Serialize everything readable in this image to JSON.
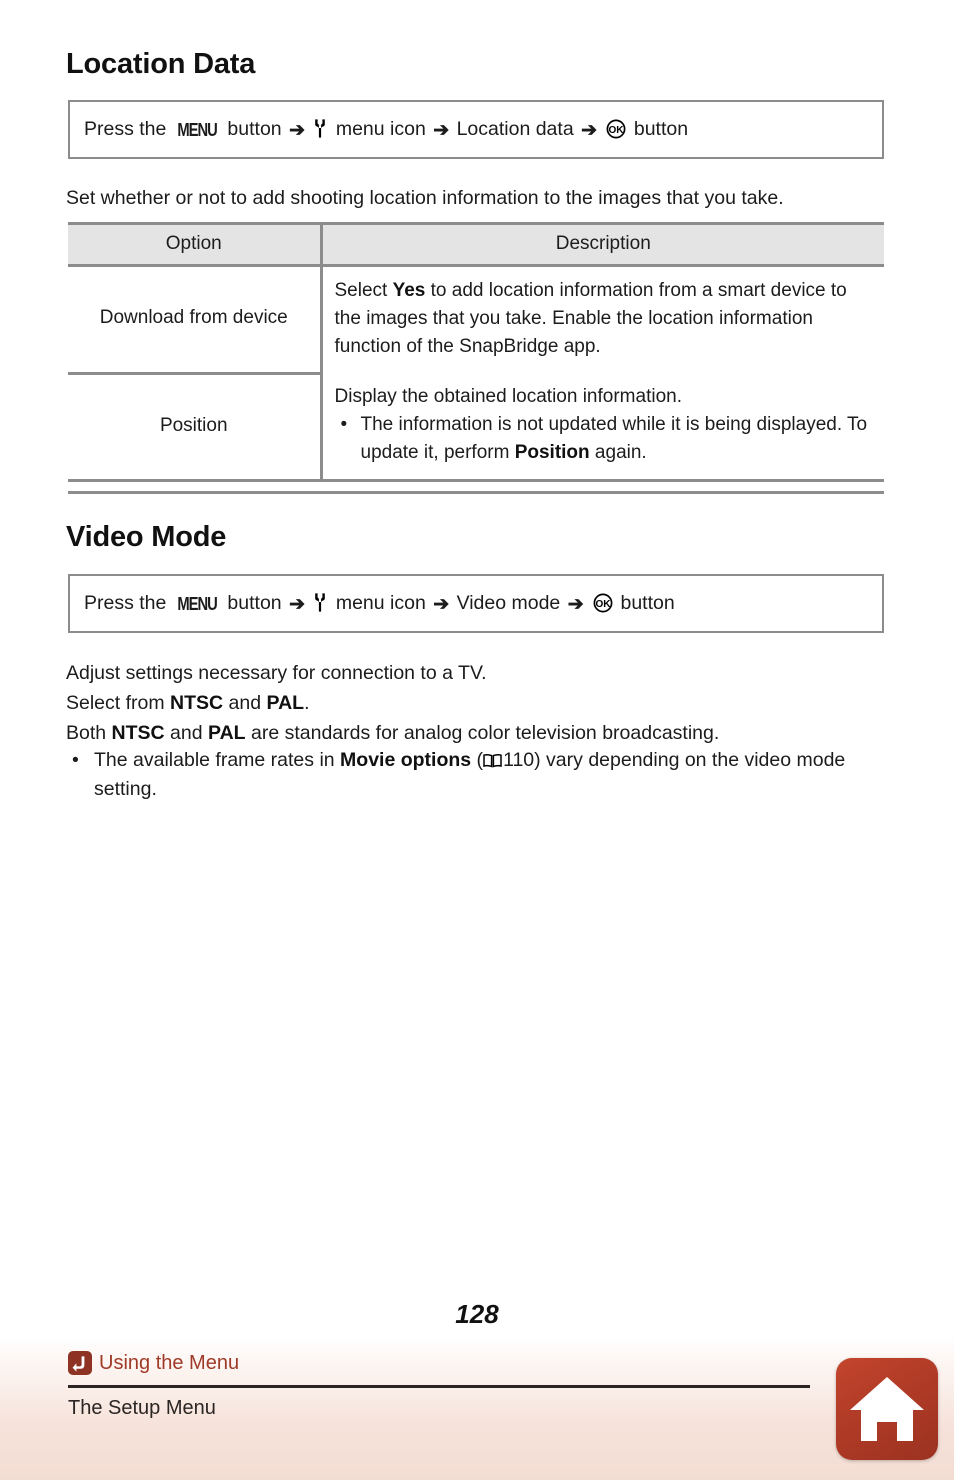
{
  "document": {
    "page_number": "128"
  },
  "location_section": {
    "title": "Location Data",
    "instruction": {
      "press_the": "Press the",
      "menu_glyph": "MENU",
      "button_1": "button",
      "arrow": "➔",
      "wrench_icon": "wrench-setup-menu-icon",
      "menu_icon_label": "menu icon",
      "item": "Location data",
      "ok_glyph": "OK",
      "button_2": "button"
    },
    "intro": "Set whether or not to add shooting location information to the images that you take.",
    "table": {
      "headers": [
        "Option",
        "Description"
      ],
      "rows": [
        {
          "option": "Download from device",
          "description_parts": [
            {
              "text": "Select ",
              "bold": false
            },
            {
              "text": "Yes",
              "bold": true
            },
            {
              "text": " to add location information from a smart device to the images that you take. Enable the location information function of the SnapBridge app.",
              "bold": false
            }
          ]
        },
        {
          "option": "Position",
          "description_lead": "Display the obtained location information.",
          "description_bullet_parts": [
            {
              "text": "The information is not updated while it is being displayed. To update it, perform ",
              "bold": false
            },
            {
              "text": "Position",
              "bold": true
            },
            {
              "text": " again.",
              "bold": false
            }
          ]
        }
      ]
    }
  },
  "video_section": {
    "title": "Video Mode",
    "instruction": {
      "press_the": "Press the",
      "menu_glyph": "MENU",
      "button_1": "button",
      "arrow": "➔",
      "wrench_icon": "wrench-setup-menu-icon",
      "menu_icon_label": "menu icon",
      "item": "Video mode",
      "ok_glyph": "OK",
      "button_2": "button"
    },
    "paragraph_1": "Adjust settings necessary for connection to a TV.",
    "paragraph_2_parts": [
      {
        "text": "Select from ",
        "bold": false
      },
      {
        "text": "NTSC",
        "bold": true
      },
      {
        "text": " and ",
        "bold": false
      },
      {
        "text": "PAL",
        "bold": true
      },
      {
        "text": ".",
        "bold": false
      }
    ],
    "paragraph_3_parts": [
      {
        "text": "Both ",
        "bold": false
      },
      {
        "text": "NTSC",
        "bold": true
      },
      {
        "text": " and ",
        "bold": false
      },
      {
        "text": "PAL",
        "bold": true
      },
      {
        "text": " are standards for analog color television broadcasting.",
        "bold": false
      }
    ],
    "bullet_parts": [
      {
        "text": "The available frame rates in ",
        "bold": false
      },
      {
        "text": "Movie options",
        "bold": true
      },
      {
        "text": " (",
        "bold": false
      },
      {
        "book_icon": "book-reference-icon"
      },
      {
        "text": "110) vary depending on the video mode setting.",
        "bold": false
      }
    ]
  },
  "footer": {
    "back_icon": "return-arrow-icon",
    "back_label": "Using the Menu",
    "subtitle": "The Setup Menu",
    "home_icon": "home-icon"
  },
  "colors": {
    "accent_red": "#a03a28",
    "back_icon_bg": "#8e3323",
    "home_button_bg": "#b23c27",
    "table_header_bg": "#e4e4e4",
    "rule_gray": "#8c8c8c"
  }
}
